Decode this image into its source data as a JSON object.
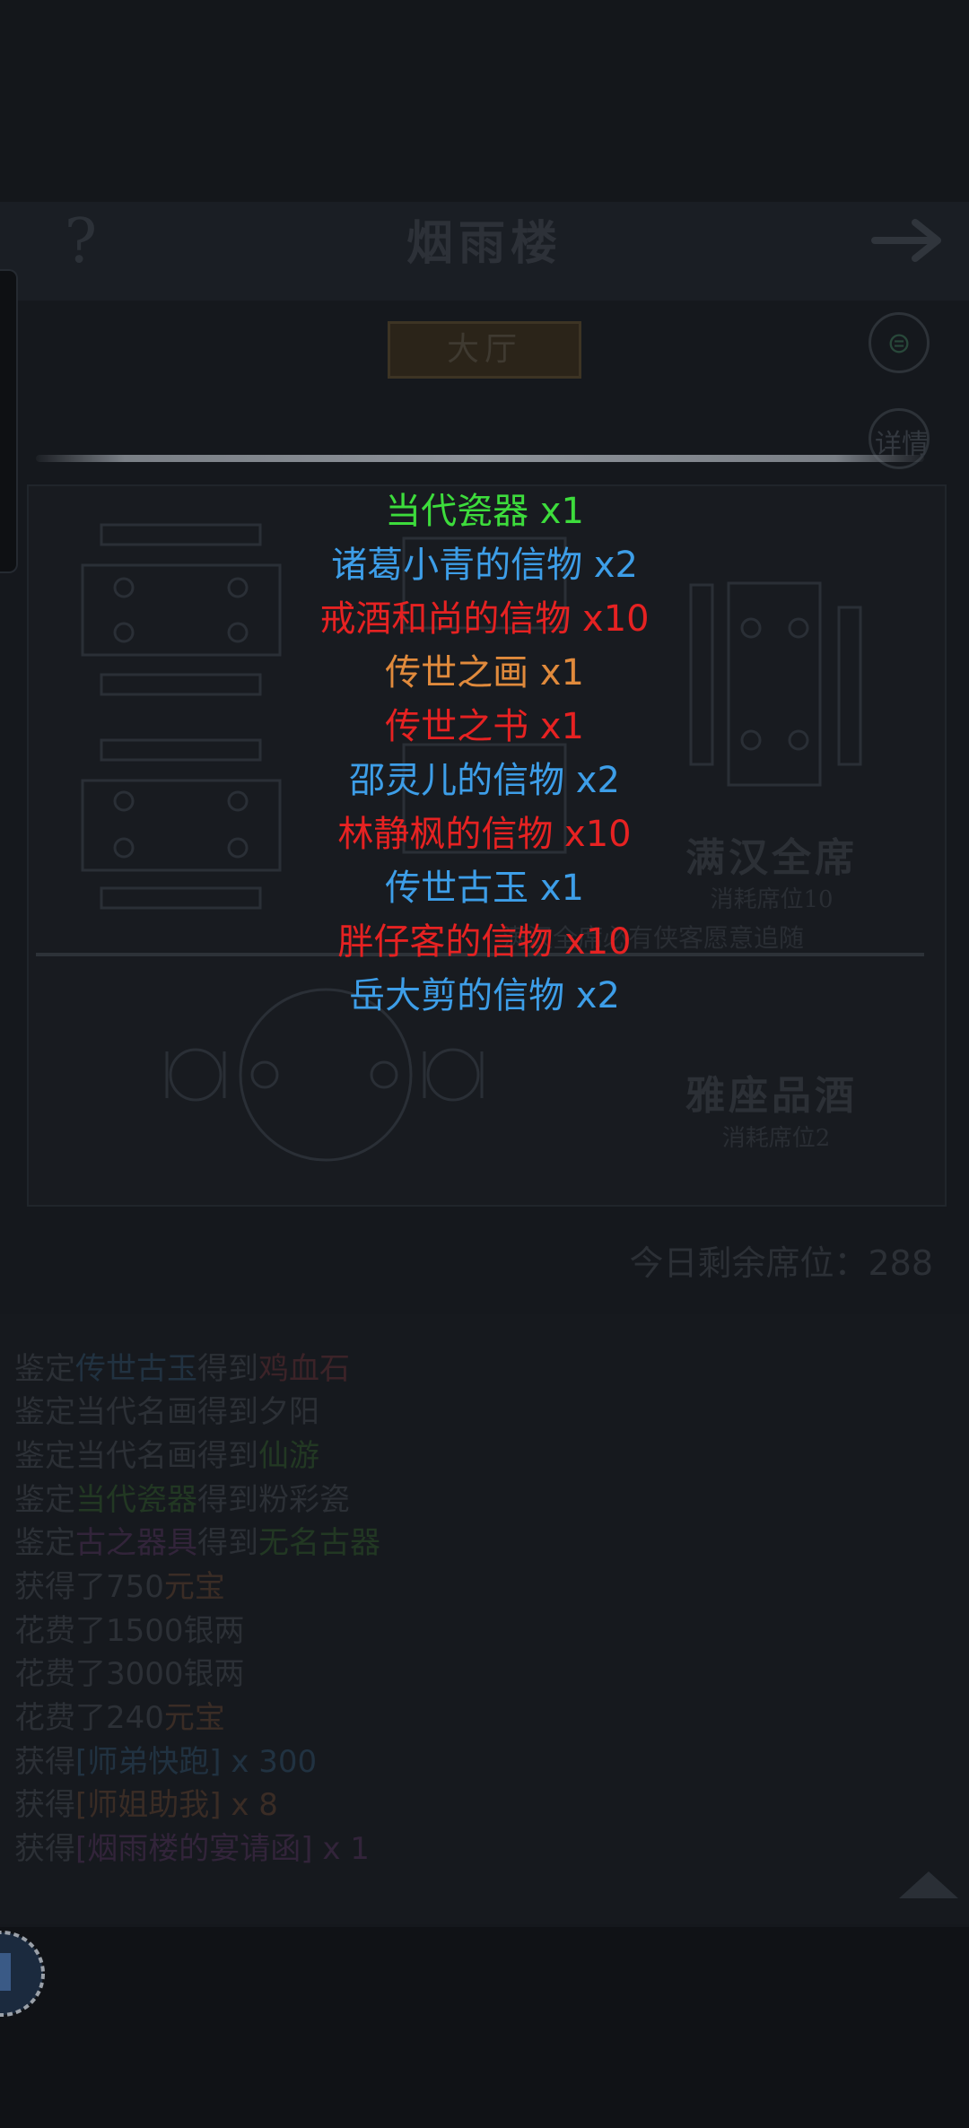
{
  "header": {
    "title": "烟雨楼",
    "help_symbol": "?"
  },
  "tabs": {
    "lobby_label": "大厅"
  },
  "side": {
    "details_label": "详情"
  },
  "banquet": {
    "title": "满汉全席",
    "cost": "消耗席位10",
    "note": "满汉全席必有侠客愿意追随"
  },
  "wine": {
    "title": "雅座品酒",
    "cost": "消耗席位2"
  },
  "seats": {
    "remaining_label": "今日剩余席位：",
    "remaining_value": "288"
  },
  "rewards": [
    {
      "name": "当代瓷器",
      "qty": "x1",
      "color": "#3ddc3c"
    },
    {
      "name": "诸葛小青的信物",
      "qty": "x2",
      "color": "#3d9ee8"
    },
    {
      "name": "戒酒和尚的信物",
      "qty": "x10",
      "color": "#e62222"
    },
    {
      "name": "传世之画",
      "qty": "x1",
      "color": "#e08a3c"
    },
    {
      "name": "传世之书",
      "qty": "x1",
      "color": "#e62222"
    },
    {
      "name": "邵灵儿的信物",
      "qty": "x2",
      "color": "#3d9ee8"
    },
    {
      "name": "林静枫的信物",
      "qty": "x10",
      "color": "#e62222"
    },
    {
      "name": "传世古玉",
      "qty": "x1",
      "color": "#3d9ee8"
    },
    {
      "name": "胖仔客的信物",
      "qty": "x10",
      "color": "#e62222"
    },
    {
      "name": "岳大剪的信物",
      "qty": "x2",
      "color": "#3d9ee8"
    }
  ],
  "log": {
    "l1": {
      "a": "鉴定",
      "b": "传世古玉",
      "c": "得到",
      "d": "鸡血石"
    },
    "l2": {
      "a": "鉴定当代名画得到夕阳"
    },
    "l3": {
      "a": "鉴定当代名画得到",
      "b": "仙游"
    },
    "l4": {
      "a": "鉴定",
      "b": "当代瓷器",
      "c": "得到粉彩瓷"
    },
    "l5": {
      "a": "鉴定",
      "b": "古之器具",
      "c": "得到",
      "d": "无名古器"
    },
    "l6": {
      "a": "获得了750",
      "b": "元宝"
    },
    "l7": {
      "a": "花费了1500银两"
    },
    "l8": {
      "a": "花费了3000银两"
    },
    "l9": {
      "a": "花费了240",
      "b": "元宝"
    },
    "l10": {
      "a": "获得",
      "b": "[师弟快跑]",
      "c": " x 300"
    },
    "l11": {
      "a": "获得",
      "b": "[师姐助我]",
      "c": " x 8"
    },
    "l12": {
      "a": "获得",
      "b": "[烟雨楼的宴请函]",
      "c": " x 1"
    }
  }
}
